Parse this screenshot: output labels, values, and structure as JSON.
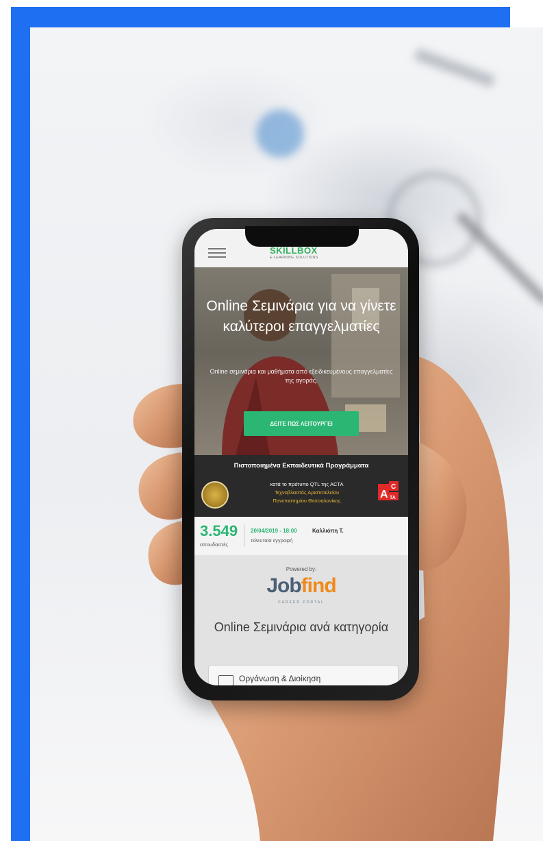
{
  "site": {
    "logo_word": "SKILLBOX",
    "logo_sub": "E-LEARNING SOLUTIONS"
  },
  "hero": {
    "title": "Online Σεμινάρια για να γίνετε καλύτεροι επαγγελματίες",
    "subtitle": "Online σεμινάρια και μαθήματα από εξειδικευμένους επαγγελματίες της αγοράς.",
    "cta_label": "ΔΕΙΤΕ ΠΩΣ ΛΕΙΤΟΥΡΓΕΙ"
  },
  "certification": {
    "title": "Πιστοποιημένα Εκπαιδευτικά Προγράμματα",
    "line1": "κατά το πρότυπο QTL της ACTA",
    "line2": "Τεχνοβλαστός Αριστοτελείου",
    "line3": "Πανεπιστημίου Θεσσαλονίκης",
    "acta_badge": "ACTA"
  },
  "stats": {
    "students_count": "3.549",
    "students_caption": "σπουδαστές",
    "last_signup_date": "20/04/2019 - 18:00",
    "last_signup_name": "Καλλιόπη Τ.",
    "last_signup_caption": "τελευταία εγγραφή"
  },
  "partner": {
    "powered_by": "Powered by:",
    "brand_left": "Job",
    "brand_right": "find",
    "brand_tagline": "CAREER PORTAL"
  },
  "categories": {
    "title": "Online Σεμινάρια ανά κατηγορία",
    "first_item": "Οργάνωση & Διοίκηση"
  },
  "colors": {
    "frame_blue": "#1f6ff2",
    "green": "#2bb673",
    "gold": "#e7b53a",
    "jobfind_blue": "#4a6076",
    "jobfind_orange": "#f08a1c"
  }
}
